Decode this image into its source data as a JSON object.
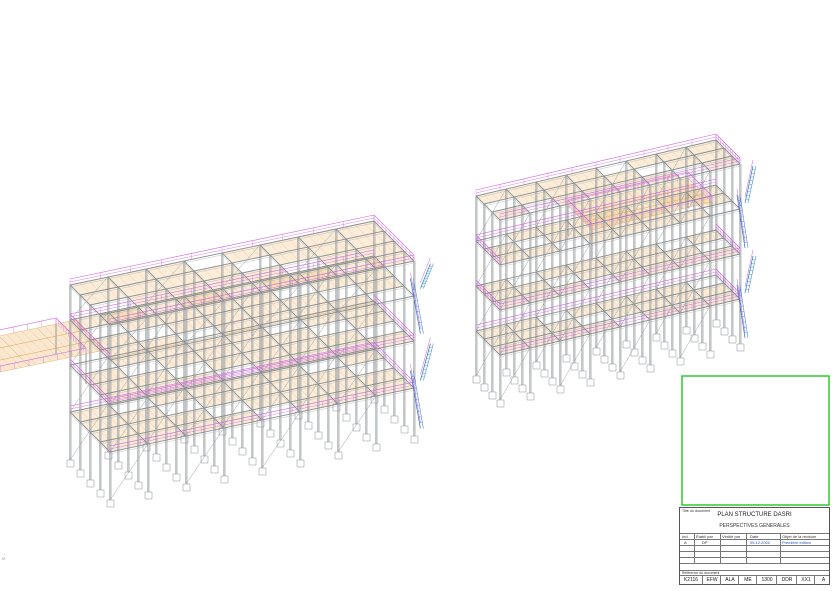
{
  "sidebar_text": "© ...",
  "title_block": {
    "doc_title_caption": "Titre du document",
    "title": "PLAN STRUCTURE DASRI",
    "subtitle": "PERSPECTIVES GENERALES",
    "table_headers": [
      "Ind.",
      "Établi par",
      "Vérifié par",
      "Date",
      "Objet de la révision"
    ],
    "revision_row": [
      "A",
      "DP",
      "",
      "05.12.2022",
      "Première édition"
    ],
    "reference_caption": "Référence du document",
    "reference_codes": [
      "K2116",
      "EFW",
      "ALA",
      "ME",
      "1300",
      "DDR",
      "XX1",
      "A"
    ]
  },
  "colors": {
    "steel": "#8a8f92",
    "grating": "#e8a860",
    "handrail": "#d060e0",
    "stair": "#3070d0",
    "cyan_detail": "#30a8c8",
    "frame_green": "#1ec81e"
  }
}
